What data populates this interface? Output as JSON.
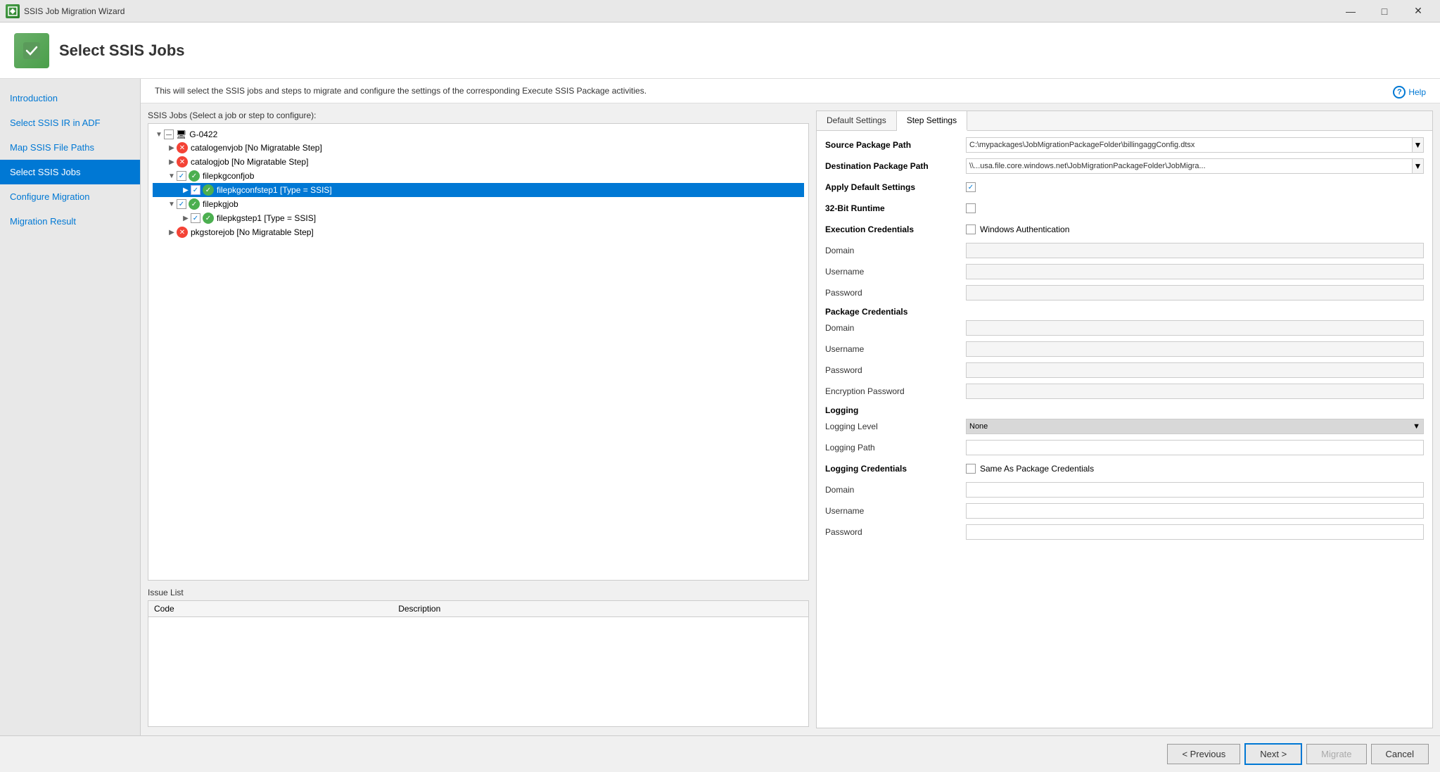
{
  "titleBar": {
    "title": "SSIS Job Migration Wizard",
    "minimize": "—",
    "maximize": "□",
    "close": "✕"
  },
  "header": {
    "title": "Select SSIS Jobs"
  },
  "sidebar": {
    "items": [
      {
        "id": "introduction",
        "label": "Introduction",
        "active": false
      },
      {
        "id": "select-ssis-ir-in-adf",
        "label": "Select SSIS IR in ADF",
        "active": false
      },
      {
        "id": "map-ssis-file-paths",
        "label": "Map SSIS File Paths",
        "active": false
      },
      {
        "id": "select-ssis-jobs",
        "label": "Select SSIS Jobs",
        "active": true
      },
      {
        "id": "configure-migration",
        "label": "Configure Migration",
        "active": false
      },
      {
        "id": "migration-result",
        "label": "Migration Result",
        "active": false
      }
    ]
  },
  "description": "This will select the SSIS jobs and steps to migrate and configure the settings of the corresponding Execute SSIS Package activities.",
  "jobsPanel": {
    "label": "SSIS Jobs (Select a job or step to configure):",
    "tree": {
      "nodes": [
        {
          "id": "root",
          "label": "G-0422",
          "indent": 0,
          "expanded": true,
          "checkbox": "indeterminate",
          "status": null
        },
        {
          "id": "catalogenvjob",
          "label": "catalogenvjob [No Migratable Step]",
          "indent": 1,
          "expanded": false,
          "checkbox": null,
          "status": "red"
        },
        {
          "id": "catalogjob",
          "label": "catalogjob [No Migratable Step]",
          "indent": 1,
          "expanded": false,
          "checkbox": null,
          "status": "red"
        },
        {
          "id": "filepkgconfjob",
          "label": "filepkgconfjob",
          "indent": 1,
          "expanded": true,
          "checkbox": "checked",
          "status": "green"
        },
        {
          "id": "filepkgconfstep1",
          "label": "filepkgconfstep1 [Type = SSIS]",
          "indent": 2,
          "expanded": false,
          "checkbox": "checked",
          "status": "green",
          "selected": true
        },
        {
          "id": "filepkgjob",
          "label": "filepkgjob",
          "indent": 1,
          "expanded": true,
          "checkbox": "checked",
          "status": "green"
        },
        {
          "id": "filepkgstep1",
          "label": "filepkgstep1 [Type = SSIS]",
          "indent": 2,
          "expanded": false,
          "checkbox": "checked",
          "status": "green"
        },
        {
          "id": "pkgstorejob",
          "label": "pkgstorejob [No Migratable Step]",
          "indent": 1,
          "expanded": false,
          "checkbox": null,
          "status": "red"
        }
      ]
    }
  },
  "issuesPanel": {
    "label": "Issue List",
    "columns": [
      "Code",
      "Description"
    ],
    "rows": []
  },
  "settingsPanel": {
    "tabs": [
      {
        "id": "default-settings",
        "label": "Default Settings",
        "active": false
      },
      {
        "id": "step-settings",
        "label": "Step Settings",
        "active": true
      }
    ],
    "sourcePackagePath": {
      "label": "Source Package Path",
      "value": "C:\\mypackages\\JobMigrationPackageFolder\\billingaggConfig.dtsx"
    },
    "destinationPackagePath": {
      "label": "Destination Package Path",
      "value": "\\\\...usa.file.core.windows.net\\JobMigrationPackageFolder\\JobMigra..."
    },
    "applyDefaultSettings": {
      "label": "Apply Default Settings",
      "checked": true
    },
    "32bitRuntime": {
      "label": "32-Bit Runtime",
      "checked": false
    },
    "executionCredentials": {
      "label": "Execution Credentials",
      "windowsAuth": "Windows Authentication",
      "checked": false
    },
    "domain": {
      "label": "Domain",
      "value": ""
    },
    "username": {
      "label": "Username",
      "value": ""
    },
    "password": {
      "label": "Password",
      "value": ""
    },
    "packageCredentials": {
      "label": "Package Credentials"
    },
    "pkgDomain": {
      "label": "Domain",
      "value": ""
    },
    "pkgUsername": {
      "label": "Username",
      "value": ""
    },
    "pkgPassword": {
      "label": "Password",
      "value": ""
    },
    "encryptionPassword": {
      "label": "Encryption Password",
      "value": ""
    },
    "logging": {
      "label": "Logging"
    },
    "loggingLevel": {
      "label": "Logging Level",
      "value": "None"
    },
    "loggingPath": {
      "label": "Logging Path",
      "value": ""
    },
    "loggingCredentials": {
      "label": "Logging Credentials",
      "sameAsPackage": "Same As Package Credentials",
      "checked": false
    },
    "logDomain": {
      "label": "Domain",
      "value": ""
    },
    "logUsername": {
      "label": "Username",
      "value": ""
    },
    "logPassword": {
      "label": "Password",
      "value": ""
    }
  },
  "footer": {
    "previousLabel": "< Previous",
    "nextLabel": "Next >",
    "migrateLabel": "Migrate",
    "cancelLabel": "Cancel"
  },
  "help": {
    "label": "Help"
  }
}
